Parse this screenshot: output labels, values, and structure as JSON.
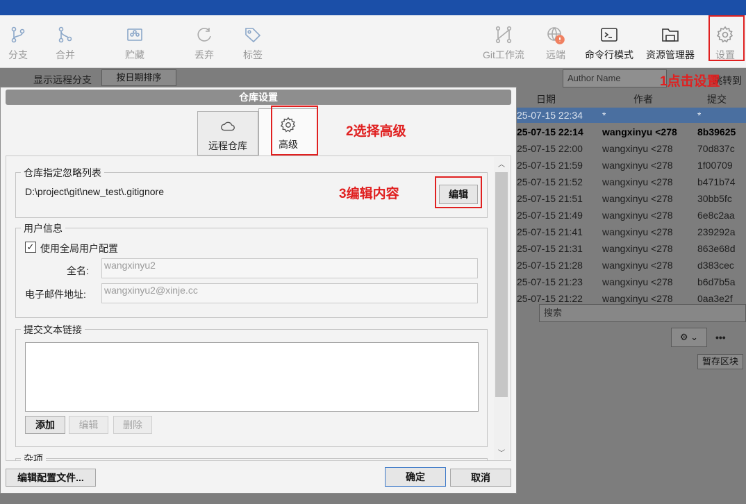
{
  "toolbar": {
    "items": [
      {
        "label": "分支",
        "icon": "branch-icon"
      },
      {
        "label": "合并",
        "icon": "merge-icon"
      },
      {
        "label": "贮藏",
        "icon": "stash-icon"
      },
      {
        "label": "丢弃",
        "icon": "discard-icon"
      },
      {
        "label": "标签",
        "icon": "tag-icon"
      },
      {
        "label": "Git工作流",
        "icon": "git-flow-icon"
      },
      {
        "label": "远端",
        "icon": "remote-icon"
      },
      {
        "label": "命令行模式",
        "icon": "terminal-icon"
      },
      {
        "label": "资源管理器",
        "icon": "explorer-icon"
      },
      {
        "label": "设置",
        "icon": "gear-icon"
      }
    ]
  },
  "background": {
    "show_remote_branches": "显示远程分支",
    "sort_label": "按日期排序",
    "author_placeholder": "Author Name",
    "jump_label": "跳转到",
    "columns": [
      "日期",
      "作者",
      "提交"
    ],
    "rows": [
      {
        "date": "25-07-15 22:34",
        "author": "*",
        "commit": "*"
      },
      {
        "date": "25-07-15 22:14",
        "author": "wangxinyu <278",
        "commit": "8b39625"
      },
      {
        "date": "25-07-15 22:00",
        "author": "wangxinyu <278",
        "commit": "70d837c"
      },
      {
        "date": "25-07-15 21:59",
        "author": "wangxinyu <278",
        "commit": "1f00709"
      },
      {
        "date": "25-07-15 21:52",
        "author": "wangxinyu <278",
        "commit": "b471b74"
      },
      {
        "date": "25-07-15 21:51",
        "author": "wangxinyu <278",
        "commit": "30bb5fc"
      },
      {
        "date": "25-07-15 21:49",
        "author": "wangxinyu <278",
        "commit": "6e8c2aa"
      },
      {
        "date": "25-07-15 21:41",
        "author": "wangxinyu <278",
        "commit": "239292a"
      },
      {
        "date": "25-07-15 21:31",
        "author": "wangxinyu <278",
        "commit": "863e68d"
      },
      {
        "date": "25-07-15 21:28",
        "author": "wangxinyu <278",
        "commit": "d383cec"
      },
      {
        "date": "25-07-15 21:23",
        "author": "wangxinyu <278",
        "commit": "b6d7b5a"
      },
      {
        "date": "25-07-15 21:22",
        "author": "wangxinyu <278",
        "commit": "0aa3e2f"
      }
    ],
    "search_placeholder": "搜索",
    "more_label": "•••",
    "stash_area_label": "暂存区块"
  },
  "dialog": {
    "title": "仓库设置",
    "tabs": [
      {
        "label": "远程仓库",
        "icon": "cloud-icon"
      },
      {
        "label": "高级",
        "icon": "gear-icon"
      }
    ],
    "ignore_group": {
      "title": "仓库指定忽略列表",
      "path": "D:\\project\\git\\new_test\\.gitignore",
      "edit_button": "编辑"
    },
    "user_group": {
      "title": "用户信息",
      "use_global": "使用全局用户配置",
      "name_label": "全名:",
      "name_value": "wangxinyu2",
      "email_label": "电子邮件地址:",
      "email_value": "wangxinyu2@xinje.cc"
    },
    "commit_links_group": {
      "title": "提交文本链接",
      "add": "添加",
      "edit": "编辑",
      "delete": "删除"
    },
    "misc_group": {
      "title": "杂项"
    },
    "edit_config": "编辑配置文件...",
    "ok": "确定",
    "cancel": "取消"
  },
  "annotations": {
    "step1": "1点击设置",
    "step2": "2选择高级",
    "step3": "3编辑内容"
  },
  "colors": {
    "annotation": "#e02020",
    "titlebar": "#1b4fa8"
  }
}
